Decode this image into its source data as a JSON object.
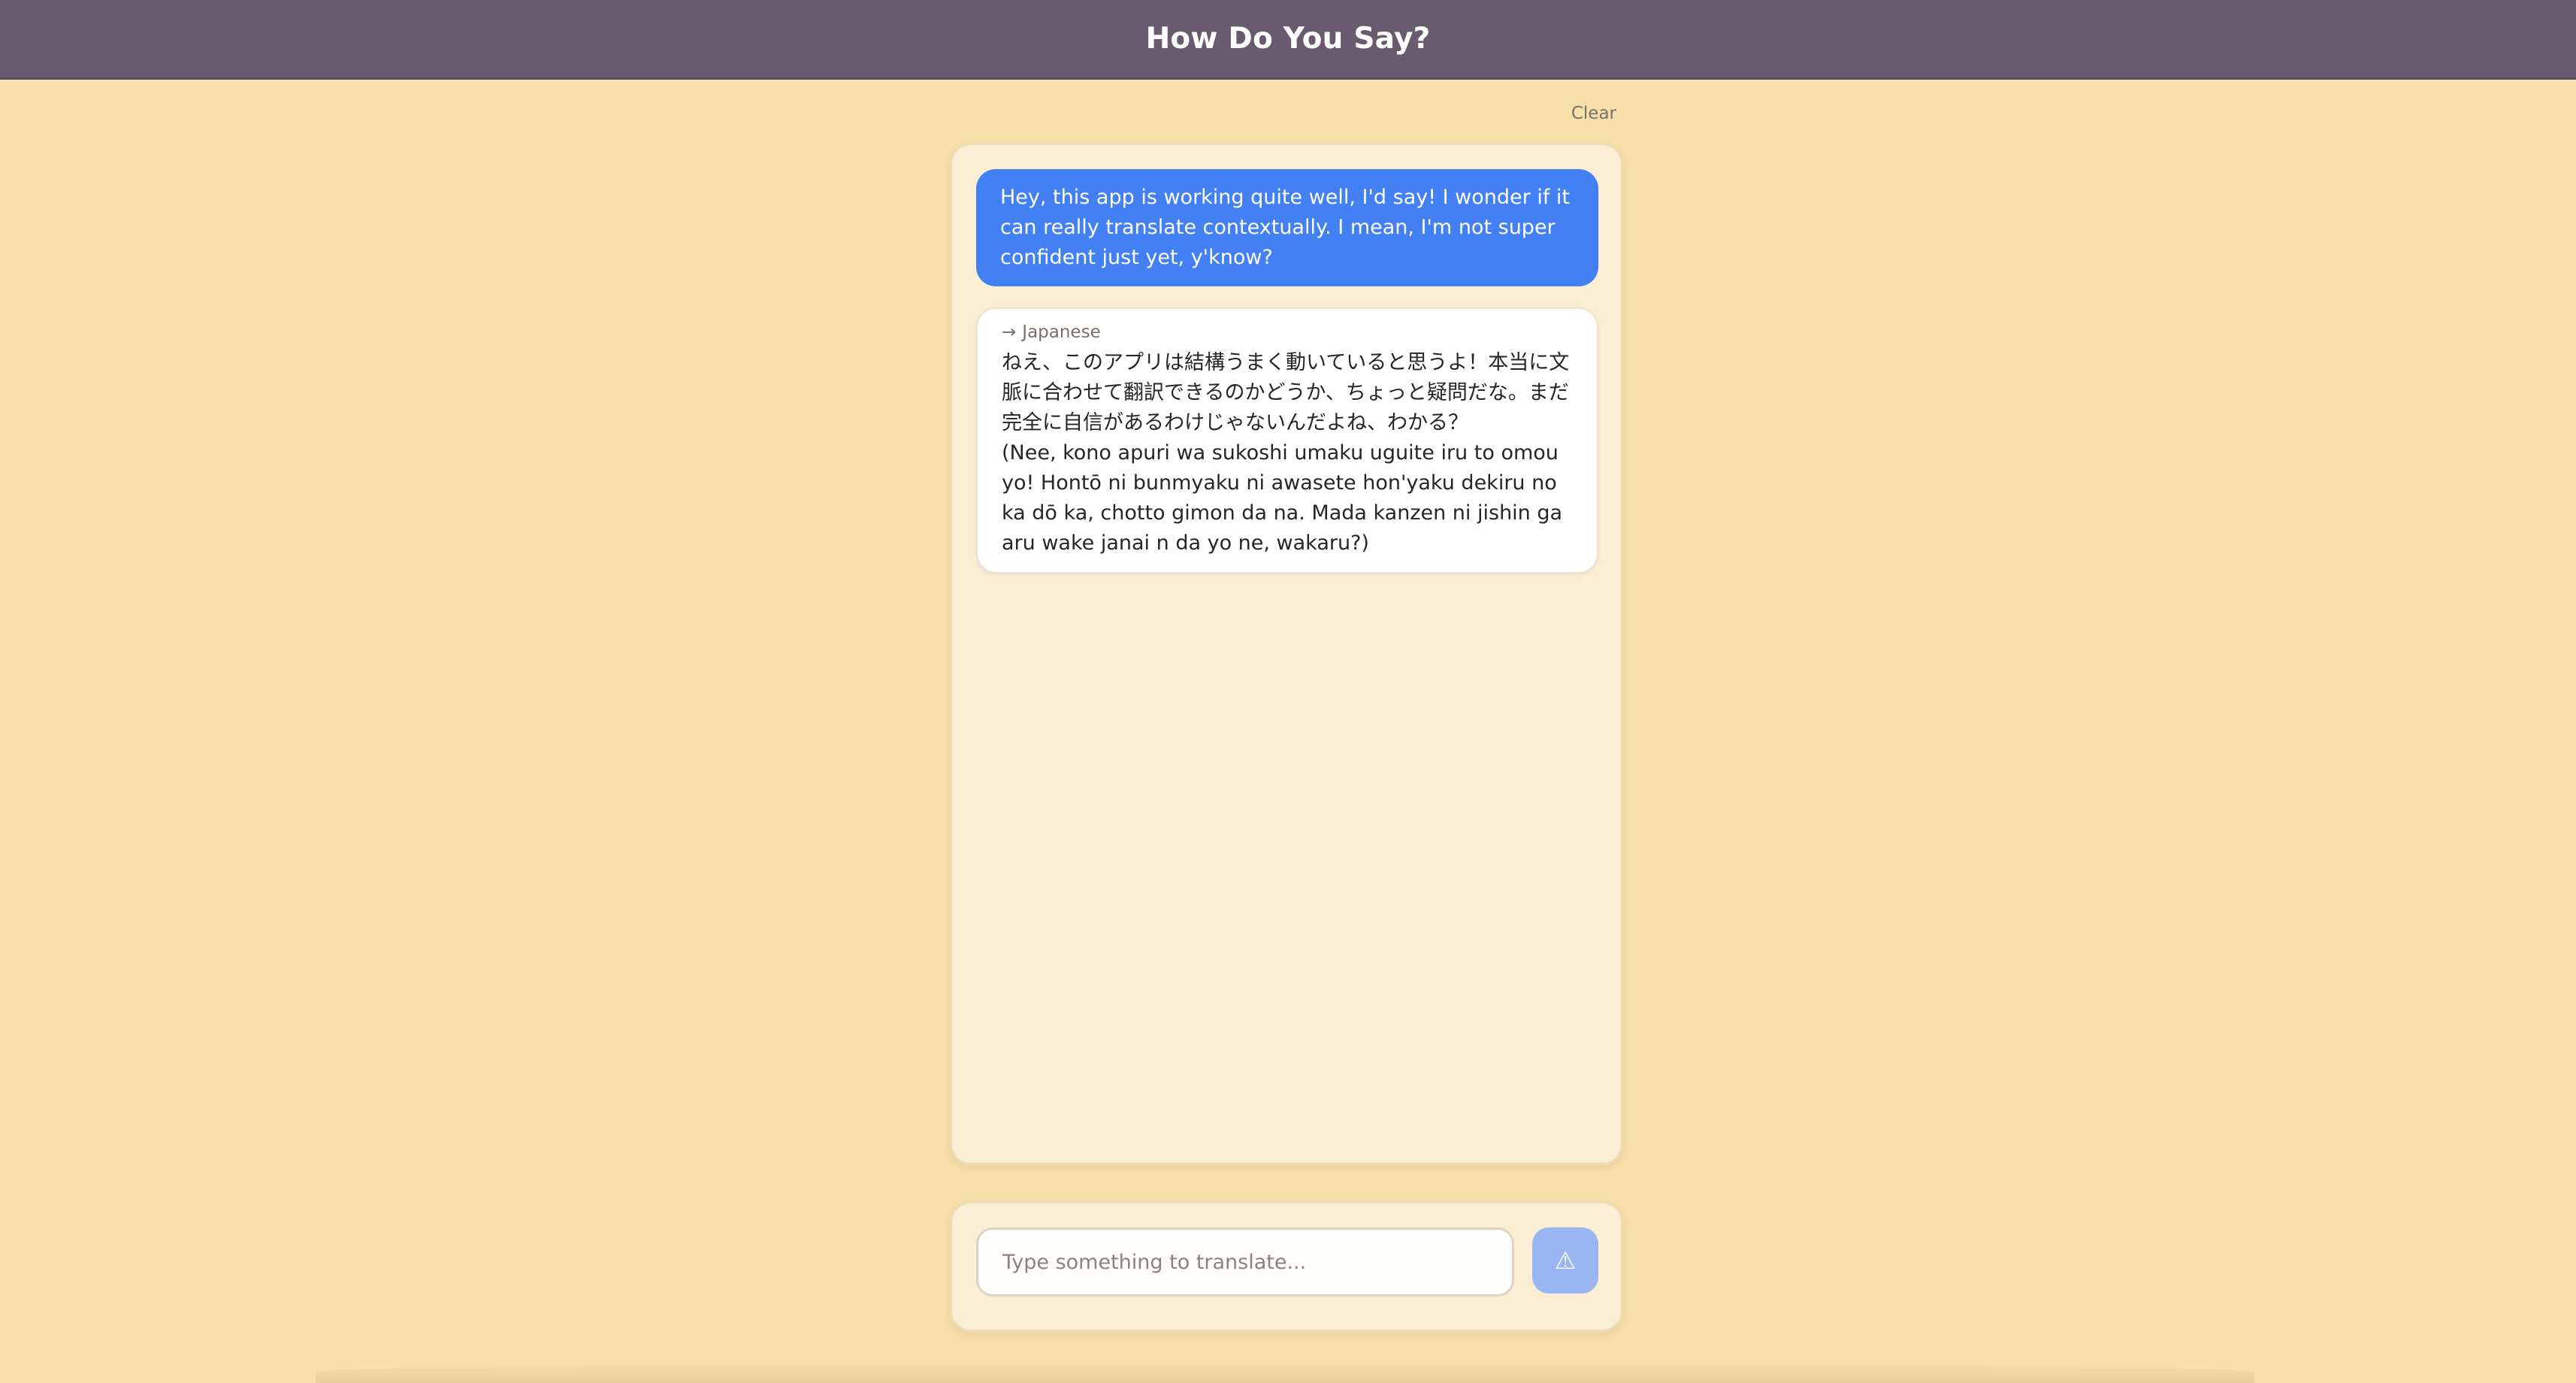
{
  "header": {
    "title": "How Do You Say?"
  },
  "toolbar": {
    "clear_label": "Clear"
  },
  "conversation": {
    "user_message": "Hey, this app is working quite well, I'd say! I wonder if it can really translate contextually. I mean, I'm not super confident just yet, y'know?",
    "translation": {
      "arrow": "→",
      "language": "Japanese",
      "japanese_text": "ねえ、このアプリは結構うまく動いていると思うよ！本当に文脈に合わせて翻訳できるのかどうか、ちょっと疑問だな。まだ完全に自信があるわけじゃないんだよね、わかる？",
      "romaji_text": "(Nee, kono apuri wa sukoshi umaku uguite iru to omou yo! Hontō ni bunmyaku ni awasete hon'yaku dekiru no ka dō ka, chotto gimon da na. Mada kanzen ni jishin ga aru wake janai n da yo ne, wakaru?)"
    }
  },
  "composer": {
    "placeholder": "Type something to translate...",
    "value": "",
    "send_icon": "⚠"
  },
  "colors": {
    "header_bg": "#6a5a70",
    "page_bg": "#f6dfaa",
    "panel_bg": "#faeed5",
    "user_bubble": "#4380f4",
    "send_button": "#9ab5f2"
  }
}
